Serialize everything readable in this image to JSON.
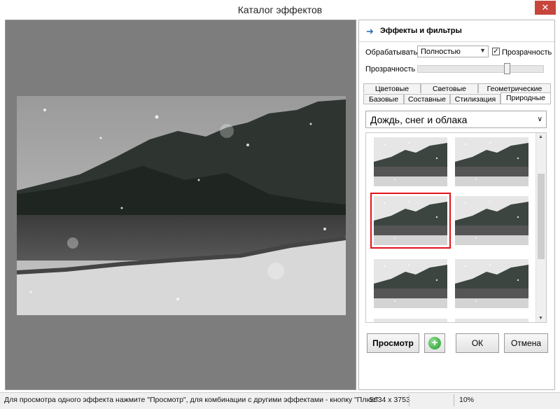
{
  "window": {
    "title": "Каталог эффектов",
    "close_label": "✕"
  },
  "panel": {
    "header": "Эффекты и фильтры",
    "process_label": "Обрабатывать",
    "process_value": "Полностью",
    "transparency_check_label": "Прозрачность",
    "transparency_checked": true,
    "transparency_slider_label": "Прозрачность",
    "transparency_level": 0.72,
    "tabs_row1": [
      "Цветовые",
      "Световые",
      "Геометрические"
    ],
    "tabs_row2": [
      "Базовые",
      "Составные",
      "Стилизация",
      "Природные"
    ],
    "active_tab": "Природные",
    "effect_category": "Дождь, снег и облака",
    "thumbnails_selected_index": 2,
    "buttons": {
      "preview": "Просмотр",
      "plus": "+",
      "ok": "ОК",
      "cancel": "Отмена"
    }
  },
  "status": {
    "hint": "Для просмотра одного эффекта нажмите \"Просмотр\", для комбинации с другими эффектами - кнопку \"Плюс\"",
    "dimensions": "5634 x 3753",
    "zoom": "10%"
  },
  "colors": {
    "accent_selection": "#e1131b",
    "preview_bg": "#7d7d7d",
    "plus_green": "#1f9a2a"
  }
}
